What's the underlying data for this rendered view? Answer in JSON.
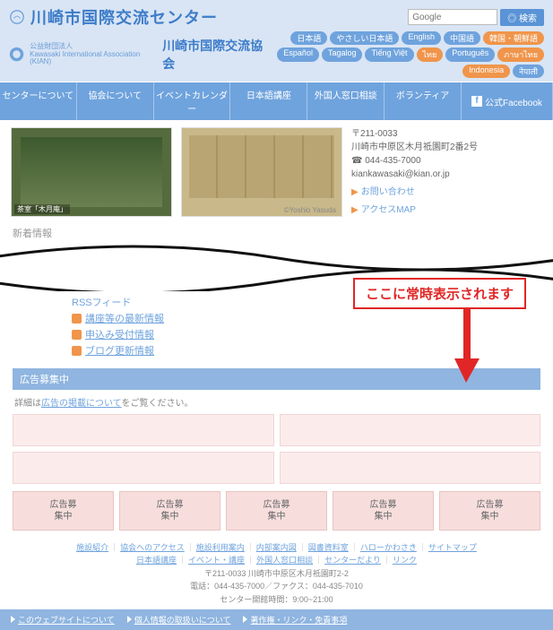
{
  "header": {
    "title": "川崎市国際交流センター",
    "assoc_small": "公益財団法人\nKawasaki International Association (KIAN)",
    "assoc_name": "川崎市国際交流協会",
    "search_placeholder": "Google",
    "search_btn": "◎ 検索"
  },
  "langs": [
    {
      "t": "日本語",
      "c": "p-blue"
    },
    {
      "t": "やさしい日本語",
      "c": "p-blue"
    },
    {
      "t": "English",
      "c": "p-blue"
    },
    {
      "t": "中国語",
      "c": "p-blue"
    },
    {
      "t": "韓国・朝鮮語",
      "c": "p-orange"
    },
    {
      "t": "Español",
      "c": "p-blue"
    },
    {
      "t": "Tagalog",
      "c": "p-blue"
    },
    {
      "t": "Tiếng Việt",
      "c": "p-blue"
    },
    {
      "t": "ไทย",
      "c": "p-orange"
    },
    {
      "t": "Português",
      "c": "p-blue"
    },
    {
      "t": "ภาษาไทย",
      "c": "p-orange"
    },
    {
      "t": "Indonesia",
      "c": "p-orange"
    },
    {
      "t": "नेपाली",
      "c": "p-blue"
    }
  ],
  "nav": [
    "センターについて",
    "協会について",
    "イベントカレンダー",
    "日本語講座",
    "外国人窓口相談",
    "ボランティア"
  ],
  "nav_fb": "公式Facebook",
  "hero": {
    "cap1": "茶室「木月庵」",
    "cap2": "©Yoshio Yasuda",
    "addr1": "〒211-0033",
    "addr2": "川崎市中原区木月祗園町2番2号",
    "tel": "☎ 044-435-7000",
    "mail": "kiankawasaki@kian.or.jp",
    "link1": "お問い合わせ",
    "link2": "アクセスMAP"
  },
  "news_label": "新着情報",
  "rss": {
    "title": "RSSフィード",
    "items": [
      "講座等の最新情報",
      "申込み受付情報",
      "ブログ更新情報"
    ]
  },
  "ads": {
    "head": "広告募集中",
    "note_pre": "詳細は",
    "note_link": "広告の掲載について",
    "note_post": "をご覧ください。",
    "slot": "広告募\n集中"
  },
  "callout": "ここに常時表示されます",
  "footer": {
    "row1": [
      "施設紹介",
      "協会へのアクセス",
      "施設利用案内",
      "内部案内図",
      "図書資料室",
      "ハローかわさき",
      "サイトマップ"
    ],
    "row2": [
      "日本語講座",
      "イベント・講座",
      "外国人窓口相談",
      "センターだより",
      "リンク"
    ],
    "addr": "〒211-0033 川崎市中原区木月祗園町2-2",
    "tel": "電話：044-435-7000／ファクス：044-435-7010",
    "hours": "センター開館時間：9:00~21:00",
    "bar1": "このウェブサイトについて",
    "bar2": "個人情報の取扱いについて",
    "bar3": "著作権・リンク・免責事項"
  }
}
